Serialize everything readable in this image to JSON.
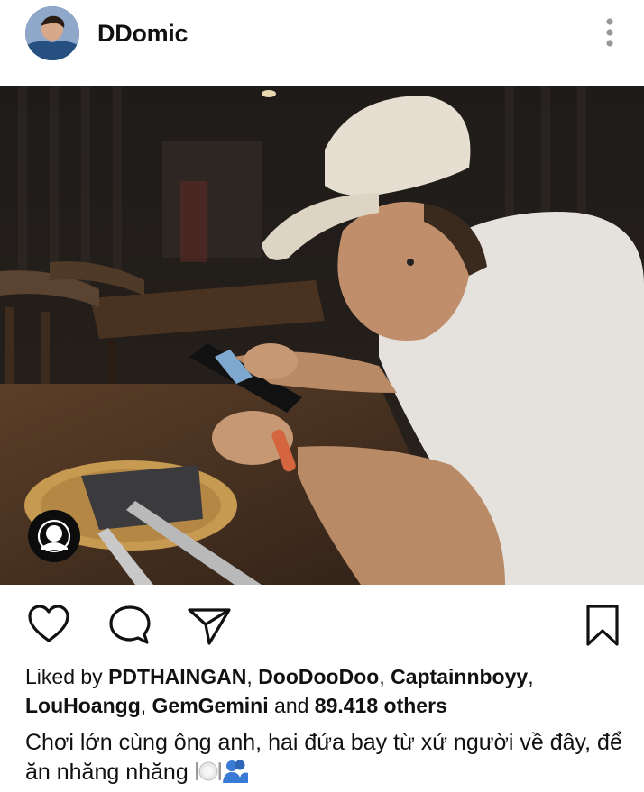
{
  "post": {
    "username": "DDomic",
    "likes": {
      "prefix": "Liked by",
      "users": [
        "PDTHAINGAN",
        "DooDooDoo",
        "Captainnboyy",
        "LouHoangg",
        "GemGemini"
      ],
      "and_label": "and",
      "others_label": "89.418 others"
    },
    "caption": "Chơi lớn cùng ông anh, hai đứa bay từ xứ người về đây, để ăn nhăng nhăng",
    "caption_emojis": [
      "plate-cutlery-emoji",
      "people-hugging-emoji"
    ]
  },
  "icons": {
    "more": "more-vertical-icon",
    "like": "heart-icon",
    "comment": "comment-icon",
    "share": "paper-plane-icon",
    "save": "bookmark-icon",
    "tag": "user-tag-icon"
  }
}
